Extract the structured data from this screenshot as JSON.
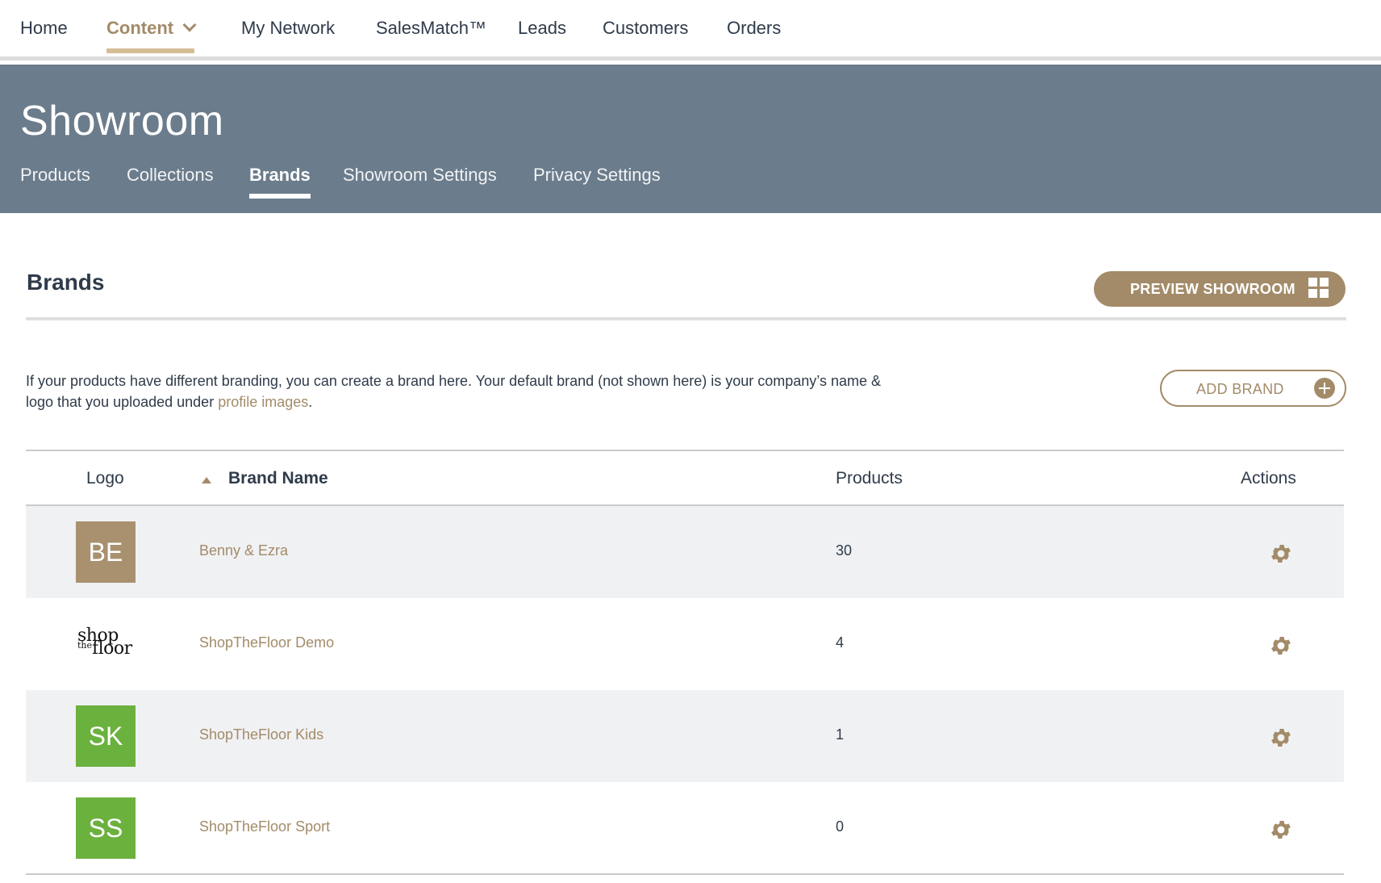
{
  "topnav": {
    "items": [
      {
        "label": "Home"
      },
      {
        "label": "Content",
        "active": true,
        "has_dropdown": true
      },
      {
        "label": "My Network"
      },
      {
        "label": "SalesMatch™"
      },
      {
        "label": "Leads"
      },
      {
        "label": "Customers"
      },
      {
        "label": "Orders"
      }
    ]
  },
  "banner": {
    "title": "Showroom",
    "tabs": [
      {
        "label": "Products"
      },
      {
        "label": "Collections"
      },
      {
        "label": "Brands",
        "active": true
      },
      {
        "label": "Showroom Settings"
      },
      {
        "label": "Privacy Settings"
      }
    ]
  },
  "section": {
    "title": "Brands",
    "preview_button": "PREVIEW SHOWROOM",
    "description_prefix": "If your products have different branding, you can create a brand here. Your default brand (not shown here) is your company’s name & logo that you uploaded under ",
    "description_link": "profile images",
    "description_suffix": ".",
    "add_button": "ADD BRAND"
  },
  "table": {
    "columns": {
      "logo": "Logo",
      "brand_name": "Brand Name",
      "products": "Products",
      "actions": "Actions"
    },
    "sort": {
      "column": "brand_name",
      "direction": "ascending"
    },
    "rows": [
      {
        "logo_text": "BE",
        "logo_color": "#a99170",
        "name": "Benny & Ezra",
        "products": "30"
      },
      {
        "logo_wordmark": {
          "line1": "shop",
          "small": "the",
          "line2": "floor"
        },
        "name": "ShopTheFloor Demo",
        "products": "4"
      },
      {
        "logo_text": "SK",
        "logo_color": "#6bb13e",
        "name": "ShopTheFloor Kids",
        "products": "1"
      },
      {
        "logo_text": "SS",
        "logo_color": "#6bb13e",
        "name": "ShopTheFloor Sport",
        "products": "0"
      }
    ]
  },
  "colors": {
    "accent": "#a38b69",
    "banner": "#6b7c8c",
    "text": "#2f3b4a",
    "row_alt": "#f0f1f3"
  }
}
